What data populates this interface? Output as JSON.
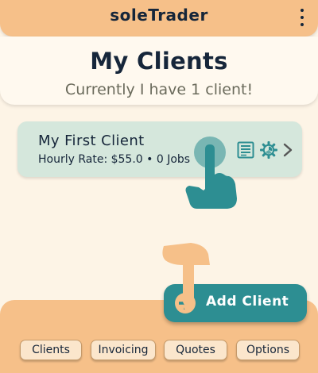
{
  "app": {
    "title": "soleTrader",
    "menu_icon": "more-vert-icon"
  },
  "header": {
    "title": "My Clients",
    "subtitle": "Currently I have 1 client!"
  },
  "clients": [
    {
      "name": "My First Client",
      "meta": "Hourly Rate: $55.0 • 0 Jobs",
      "icons": [
        "document-list-icon",
        "gear-icon",
        "chevron-right-icon"
      ]
    }
  ],
  "fab": {
    "label": "Add Client",
    "icon": "add-icon"
  },
  "bottom_nav": {
    "items": [
      {
        "label": "Clients"
      },
      {
        "label": "Invoicing"
      },
      {
        "label": "Quotes"
      },
      {
        "label": "Options"
      }
    ]
  },
  "colors": {
    "accent_orange": "#f6c089",
    "teal": "#2d8e92",
    "card_green": "#d5e7dc",
    "background": "#fdf4e6",
    "text_dark": "#16263a"
  },
  "hints": [
    "tap-hand-icon",
    "swipe-up-hand-icon"
  ]
}
